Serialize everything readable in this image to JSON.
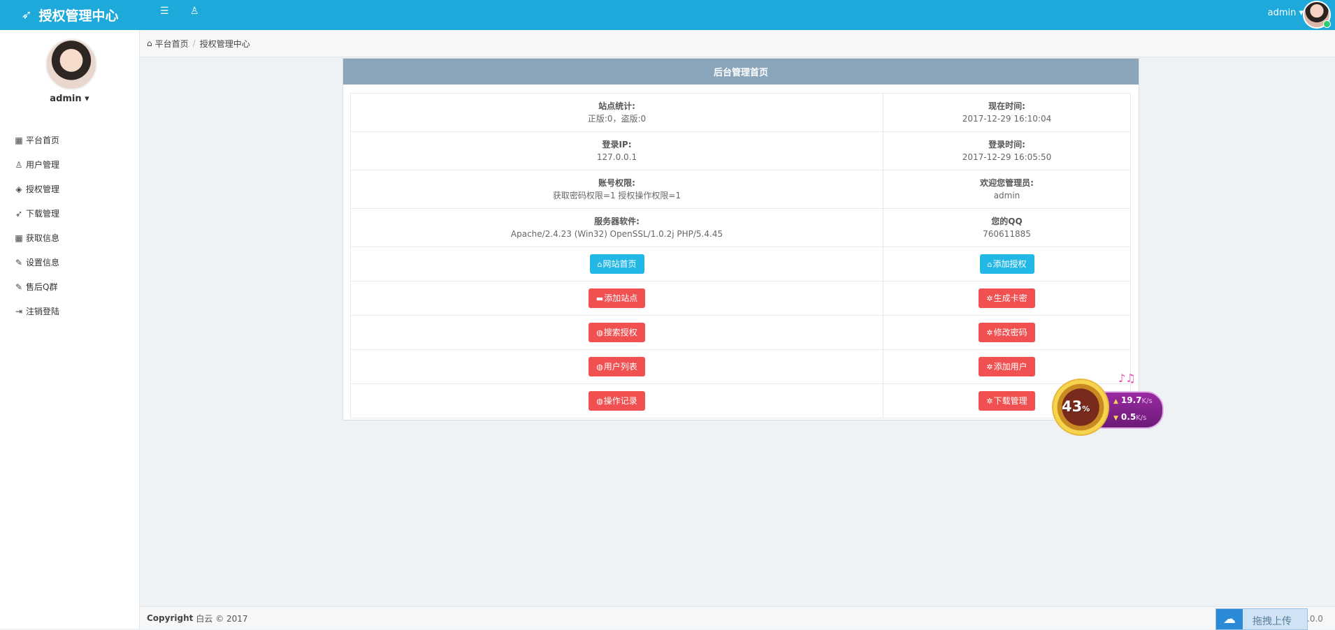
{
  "app": {
    "title": "授权管理中心"
  },
  "topbar": {
    "user": "admin ▾"
  },
  "sidebar": {
    "username": "admin ▾",
    "items": [
      {
        "icon": "grid-icon",
        "glyph": "▦",
        "label": "平台首页"
      },
      {
        "icon": "user-icon",
        "glyph": "♙",
        "label": "用户管理"
      },
      {
        "icon": "layers-icon",
        "glyph": "◈",
        "label": "授权管理"
      },
      {
        "icon": "rocket-icon",
        "glyph": "➶",
        "label": "下载管理"
      },
      {
        "icon": "grid-icon",
        "glyph": "▦",
        "label": "获取信息"
      },
      {
        "icon": "edit-icon",
        "glyph": "✎",
        "label": "设置信息"
      },
      {
        "icon": "edit-icon",
        "glyph": "✎",
        "label": "售后Q群"
      },
      {
        "icon": "logout-icon",
        "glyph": "⇥",
        "label": "注销登陆"
      }
    ]
  },
  "breadcrumb": {
    "home": "平台首页",
    "current": "授权管理中心"
  },
  "panel": {
    "title": "后台管理首页",
    "rows": [
      {
        "left_label": "站点统计:",
        "left_value": "正版:0，盗版:0",
        "right_label": "现在时间:",
        "right_value": "2017-12-29 16:10:04"
      },
      {
        "left_label": "登录IP:",
        "left_value": "127.0.0.1",
        "right_label": "登录时间:",
        "right_value": "2017-12-29 16:05:50"
      },
      {
        "left_label": "账号权限:",
        "left_value": "获取密码权限=1 授权操作权限=1",
        "right_label": "欢迎您管理员:",
        "right_value": "admin"
      },
      {
        "left_label": "服务器软件:",
        "left_value": "Apache/2.4.23 (Win32) OpenSSL/1.0.2j PHP/5.4.45",
        "right_label": "您的QQ",
        "right_value": "760611885"
      }
    ],
    "buttons": [
      {
        "left": {
          "icon": "home-icon",
          "glyph": "⌂",
          "label": "网站首页",
          "color": "#23b7e5"
        },
        "right": {
          "icon": "home-icon",
          "glyph": "⌂",
          "label": "添加授权",
          "color": "#23b7e5"
        }
      },
      {
        "left": {
          "icon": "folder-icon",
          "glyph": "▬",
          "label": "添加站点",
          "color": "#f05050"
        },
        "right": {
          "icon": "gear-icon",
          "glyph": "✲",
          "label": "生成卡密",
          "color": "#f05050"
        }
      },
      {
        "left": {
          "icon": "globe-icon",
          "glyph": "◍",
          "label": "搜索授权",
          "color": "#f05050"
        },
        "right": {
          "icon": "gear-icon",
          "glyph": "✲",
          "label": "修改密码",
          "color": "#f05050"
        }
      },
      {
        "left": {
          "icon": "globe-icon",
          "glyph": "◍",
          "label": "用户列表",
          "color": "#f05050"
        },
        "right": {
          "icon": "gear-icon",
          "glyph": "✲",
          "label": "添加用户",
          "color": "#f05050"
        }
      },
      {
        "left": {
          "icon": "globe-icon",
          "glyph": "◍",
          "label": "操作记录",
          "color": "#f05050"
        },
        "right": {
          "icon": "gear-icon",
          "glyph": "✲",
          "label": "下载管理",
          "color": "#f05050"
        }
      }
    ]
  },
  "footer": {
    "copyright": "Copyright",
    "text": "白云 © 2017"
  },
  "speed_widget": {
    "percent": "43",
    "percent_sign": "%",
    "upload": "19.7",
    "download": "0.5",
    "unit": "K/s"
  },
  "upload_widget": {
    "label": "拖拽上传"
  },
  "footer_tail": ".0.0"
}
